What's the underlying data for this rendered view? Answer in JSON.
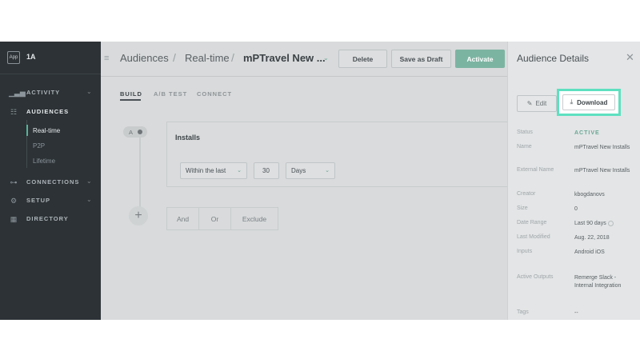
{
  "app": {
    "badge": "App",
    "name": "1A"
  },
  "sidebar": {
    "items": [
      {
        "label": "ACTIVITY",
        "icon": "bar-chart-icon"
      },
      {
        "label": "AUDIENCES",
        "icon": "people-icon"
      },
      {
        "label": "CONNECTIONS",
        "icon": "connections-icon"
      },
      {
        "label": "SETUP",
        "icon": "gear-icon"
      },
      {
        "label": "DIRECTORY",
        "icon": "grid-icon"
      }
    ],
    "sub_items": [
      "Real-time",
      "P2P",
      "Lifetime"
    ]
  },
  "header": {
    "crumbs": [
      "Audiences",
      "Real-time",
      "mPTravel New ..."
    ],
    "buttons": {
      "delete": "Delete",
      "save_draft": "Save as Draft",
      "activate": "Activate"
    }
  },
  "tabs": [
    "BUILD",
    "A/B TEST",
    "CONNECT"
  ],
  "builder": {
    "group_label": "A",
    "rule_title": "Installs",
    "condition": "Within the last",
    "amount": "30",
    "unit": "Days",
    "logic": [
      "And",
      "Or",
      "Exclude"
    ]
  },
  "panel": {
    "title": "Audience Details",
    "edit_label": "Edit",
    "download_label": "Download",
    "rows": [
      {
        "label": "Status",
        "value": "ACTIVE"
      },
      {
        "label": "Name",
        "value": "mPTravel New Installs"
      },
      {
        "label": "External Name",
        "value": "mPTravel New Installs"
      },
      {
        "label": "Creator",
        "value": "kbogdanovs"
      },
      {
        "label": "Size",
        "value": "0"
      },
      {
        "label": "Date Range",
        "value": "Last 90 days"
      },
      {
        "label": "Last Modified",
        "value": "Aug. 22, 2018"
      },
      {
        "label": "Inputs",
        "value": "Android iOS"
      },
      {
        "label": "Active Outputs",
        "value": "Remerge Slack - Internal Integration"
      },
      {
        "label": "Tags",
        "value": "--"
      }
    ]
  },
  "colors": {
    "accent": "#7cb4a2",
    "highlight": "#5ee0c0",
    "sidebar": "#2c3236"
  }
}
